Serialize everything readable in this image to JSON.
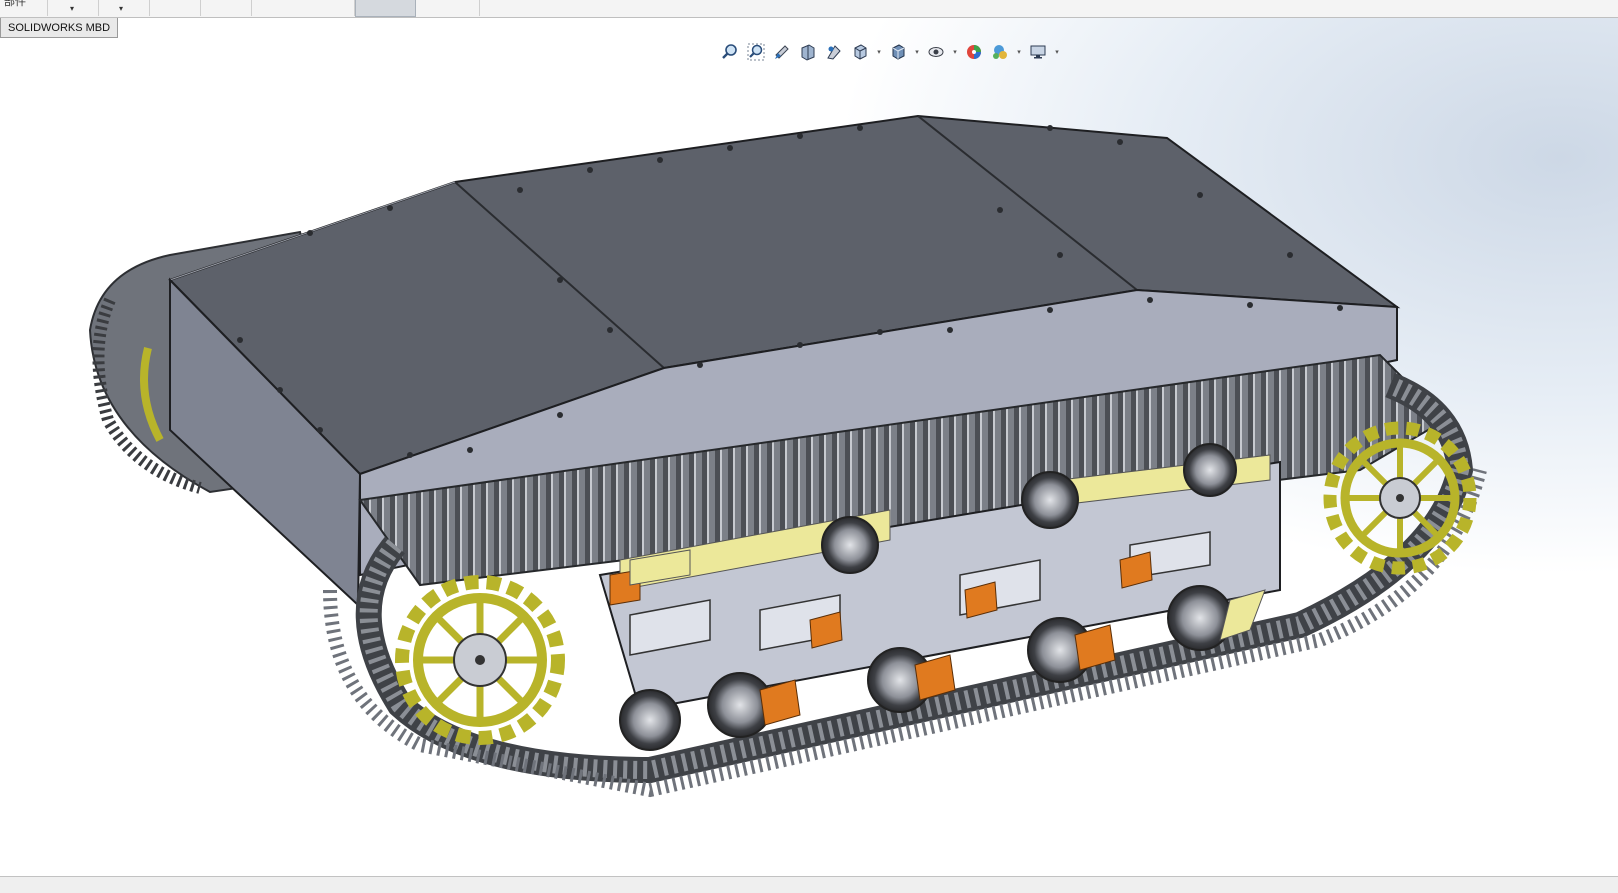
{
  "topbar": {
    "part_label": "部件",
    "dropdown_caret": "▾"
  },
  "mbd_tab": {
    "label": "SOLIDWORKS MBD"
  },
  "view_toolbar": {
    "tools": [
      "zoom-to-fit-icon",
      "zoom-to-area-icon",
      "previous-view-icon",
      "section-view-icon",
      "dynamic-annotation-views-icon",
      "view-orientation-icon",
      "display-style-icon",
      "hide-show-items-icon",
      "edit-appearance-icon",
      "apply-scene-icon",
      "view-settings-icon"
    ],
    "caret": "▾"
  },
  "model": {
    "colors": {
      "chassis_top": "#5d616a",
      "chassis_side": "#a9adbc",
      "track": "#5a5d63",
      "sprocket": "#b8b42a",
      "roller_arm_orange": "#e07a1f",
      "roller_arm_yellow": "#ece89a",
      "frame_plate": "#c3c7d3"
    }
  }
}
